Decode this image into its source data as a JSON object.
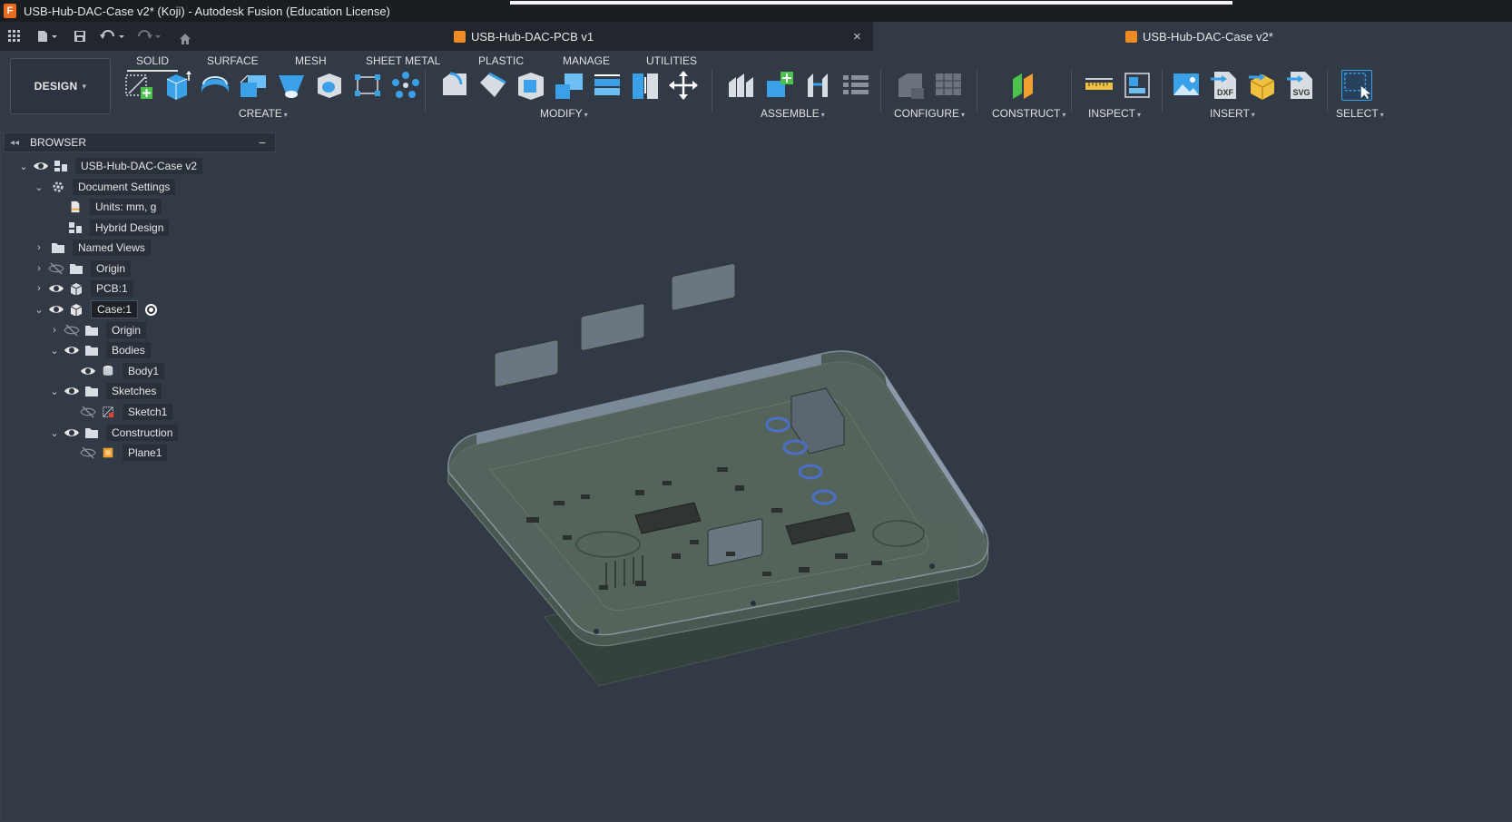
{
  "window": {
    "title": "USB-Hub-DAC-Case v2* (Koji) - Autodesk Fusion (Education License)"
  },
  "tabs": [
    {
      "label": "USB-Hub-DAC-PCB v1",
      "close": "×"
    },
    {
      "label": "USB-Hub-DAC-Case v2*"
    }
  ],
  "workspace": {
    "label": "DESIGN",
    "caret": "▾"
  },
  "ribbon_tabs": [
    "SOLID",
    "SURFACE",
    "MESH",
    "SHEET METAL",
    "PLASTIC",
    "MANAGE",
    "UTILITIES"
  ],
  "groups": {
    "create": "CREATE",
    "modify": "MODIFY",
    "assemble": "ASSEMBLE",
    "configure": "CONFIGURE",
    "construct": "CONSTRUCT",
    "inspect": "INSPECT",
    "insert": "INSERT",
    "select": "SELECT"
  },
  "insert_badges": {
    "dxf": "DXF",
    "svg": "SVG"
  },
  "browser": {
    "title": "BROWSER",
    "collapse": "◂◂",
    "minimize": "−",
    "items": [
      {
        "label": "USB-Hub-DAC-Case v2"
      },
      {
        "label": "Document Settings"
      },
      {
        "label": "Units: mm, g"
      },
      {
        "label": "Hybrid Design"
      },
      {
        "label": "Named Views"
      },
      {
        "label": "Origin"
      },
      {
        "label": "PCB:1"
      },
      {
        "label": "Case:1"
      },
      {
        "label": "Origin"
      },
      {
        "label": "Bodies"
      },
      {
        "label": "Body1"
      },
      {
        "label": "Sketches"
      },
      {
        "label": "Sketch1"
      },
      {
        "label": "Construction"
      },
      {
        "label": "Plane1"
      }
    ]
  },
  "colors": {
    "background": "#323a46",
    "toolbar": "#323a46",
    "titlebar": "#1a1d22",
    "accent_blue": "#3aa0e8",
    "accent_orange": "#f08a24"
  },
  "icons": {
    "app": "autodesk-fusion-icon",
    "eye": "eye-icon",
    "eye_hidden": "eye-slash-icon",
    "folder": "folder-icon",
    "gear": "gear-icon"
  }
}
